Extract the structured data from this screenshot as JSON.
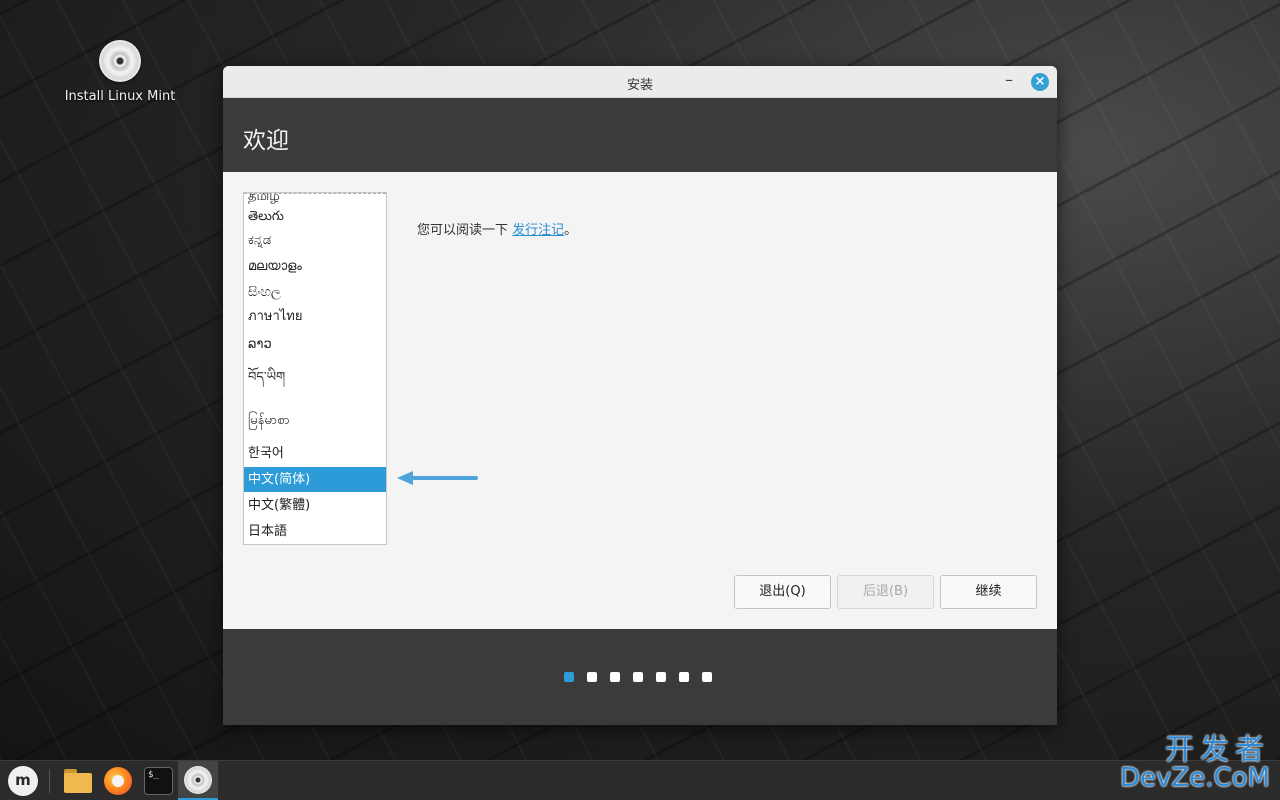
{
  "desktop": {
    "icon_label": "Install Linux Mint",
    "icon": "disc-icon"
  },
  "window": {
    "title": "安装",
    "controls": {
      "minimize": "–",
      "close": "×"
    },
    "header_title": "欢迎",
    "languages": [
      "தமிழ்",
      "తెలుగు",
      "ಕನ್ನಡ",
      "മലയാളം",
      "සිංහල",
      "ภาษาไทย",
      "ລາວ",
      "བོད་ཡིག",
      "မြန်မာစာ",
      "한국어",
      "中文(简体)",
      "中文(繁體)",
      "日本語"
    ],
    "selected_language": "中文(简体)",
    "release_notes": {
      "prefix": "您可以阅读一下 ",
      "link": "发行注记",
      "suffix": "。"
    },
    "buttons": {
      "quit": "退出(Q)",
      "back": "后退(B)",
      "continue": "继续"
    },
    "step_indicator": {
      "total": 7,
      "current": 1
    }
  },
  "taskbar": {
    "items": [
      "mint-menu-icon",
      "folder-icon",
      "firefox-icon",
      "terminal-icon",
      "installer-icon"
    ],
    "terminal_glyph": "$_"
  },
  "watermark": {
    "line1": "开发者",
    "line2": "DevZe.CoM"
  },
  "colors": {
    "accent": "#2d9bd7",
    "header": "#3b3b3b",
    "link": "#2d8fd0"
  }
}
